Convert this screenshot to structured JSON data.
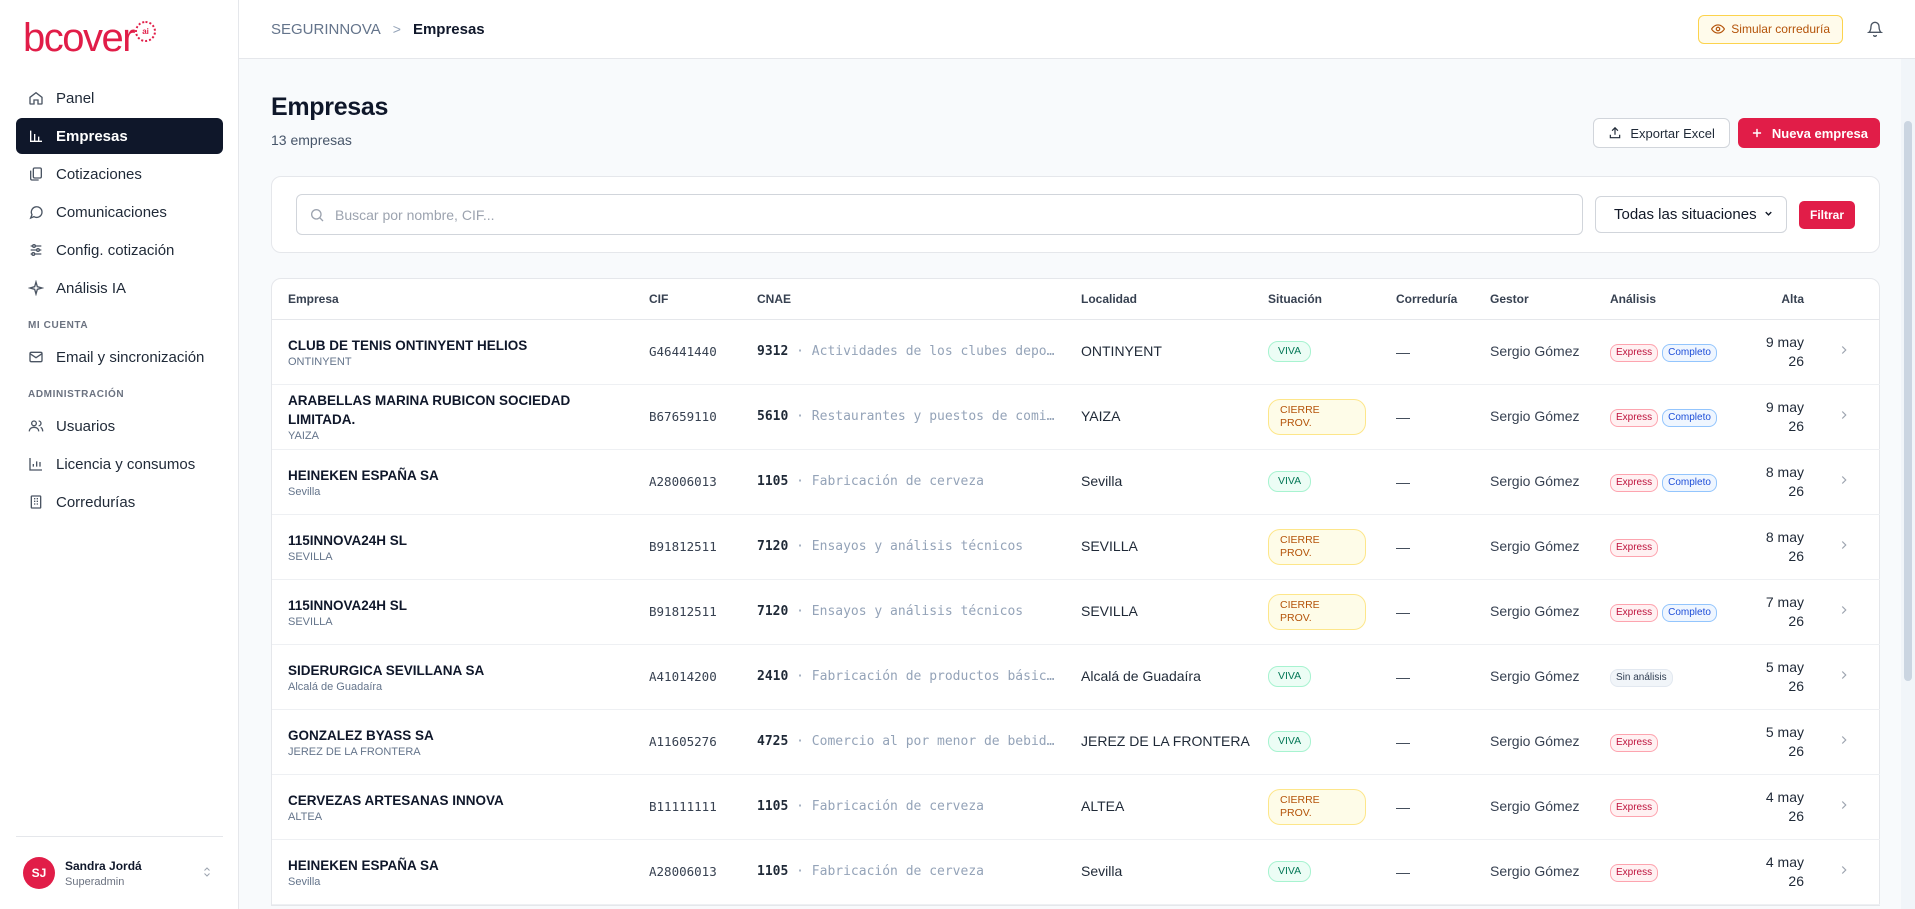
{
  "brand": {
    "logo": "bcover",
    "badge": "ai",
    "accent": "#e11d48"
  },
  "nav": {
    "items": [
      {
        "label": "Panel",
        "icon": "home-icon"
      },
      {
        "label": "Empresas",
        "icon": "bar-chart-icon",
        "active": true
      },
      {
        "label": "Cotizaciones",
        "icon": "copy-icon"
      },
      {
        "label": "Comunicaciones",
        "icon": "message-icon"
      },
      {
        "label": "Config. cotización",
        "icon": "sliders-icon"
      },
      {
        "label": "Análisis IA",
        "icon": "sparkle-icon"
      }
    ],
    "section_account": "MI CUENTA",
    "account_items": [
      {
        "label": "Email y sincronización",
        "icon": "mail-icon"
      }
    ],
    "section_admin": "ADMINISTRACIÓN",
    "admin_items": [
      {
        "label": "Usuarios",
        "icon": "users-icon"
      },
      {
        "label": "Licencia y consumos",
        "icon": "chart-icon"
      },
      {
        "label": "Corredurías",
        "icon": "building-icon"
      }
    ]
  },
  "user": {
    "initials": "SJ",
    "name": "Sandra Jordá",
    "role": "Superadmin"
  },
  "breadcrumb": {
    "root": "SEGURINNOVA",
    "sep": ">",
    "current": "Empresas"
  },
  "topbar": {
    "simulate_label": "Simular correduría"
  },
  "page": {
    "title": "Empresas",
    "count": "13",
    "count_suffix": " empresas",
    "export_label": "Exportar Excel",
    "new_label": "Nueva empresa"
  },
  "filters": {
    "search_placeholder": "Buscar por nombre, CIF...",
    "situation_selected": "Todas las situaciones",
    "filter_label": "Filtrar"
  },
  "table": {
    "headers": [
      "Empresa",
      "CIF",
      "CNAE",
      "Localidad",
      "Situación",
      "Correduría",
      "Gestor",
      "Análisis",
      "Alta"
    ],
    "rows": [
      {
        "name": "CLUB DE TENIS ONTINYENT HELIOS",
        "loc": "ONTINYENT",
        "cif": "G46441440",
        "cnae_code": "9312",
        "cnae_desc": " · Actividades de los clubes depo…",
        "localidad": "ONTINYENT",
        "situacion": "VIVA",
        "correduria": "—",
        "gestor": "Sergio Gómez",
        "analisis": [
          "Express",
          "Completo"
        ],
        "alta": "9 may 26"
      },
      {
        "name": "ARABELLAS MARINA RUBICON SOCIEDAD LIMITADA.",
        "loc": "YAIZA",
        "cif": "B67659110",
        "cnae_code": "5610",
        "cnae_desc": " · Restaurantes y puestos de comi…",
        "localidad": "YAIZA",
        "situacion": "CIERRE PROV.",
        "correduria": "—",
        "gestor": "Sergio Gómez",
        "analisis": [
          "Express",
          "Completo"
        ],
        "alta": "9 may 26"
      },
      {
        "name": "HEINEKEN ESPAÑA SA",
        "loc": "Sevilla",
        "cif": "A28006013",
        "cnae_code": "1105",
        "cnae_desc": " · Fabricación de cerveza",
        "localidad": "Sevilla",
        "situacion": "VIVA",
        "correduria": "—",
        "gestor": "Sergio Gómez",
        "analisis": [
          "Express",
          "Completo"
        ],
        "alta": "8 may 26"
      },
      {
        "name": "115INNOVA24H SL",
        "loc": "SEVILLA",
        "cif": "B91812511",
        "cnae_code": "7120",
        "cnae_desc": " · Ensayos y análisis técnicos",
        "localidad": "SEVILLA",
        "situacion": "CIERRE PROV.",
        "correduria": "—",
        "gestor": "Sergio Gómez",
        "analisis": [
          "Express"
        ],
        "alta": "8 may 26"
      },
      {
        "name": "115INNOVA24H SL",
        "loc": "SEVILLA",
        "cif": "B91812511",
        "cnae_code": "7120",
        "cnae_desc": " · Ensayos y análisis técnicos",
        "localidad": "SEVILLA",
        "situacion": "CIERRE PROV.",
        "correduria": "—",
        "gestor": "Sergio Gómez",
        "analisis": [
          "Express",
          "Completo"
        ],
        "alta": "7 may 26"
      },
      {
        "name": "SIDERURGICA SEVILLANA SA",
        "loc": "Alcalá de Guadaíra",
        "cif": "A41014200",
        "cnae_code": "2410",
        "cnae_desc": " · Fabricación de productos básic…",
        "localidad": "Alcalá de Guadaíra",
        "situacion": "VIVA",
        "correduria": "—",
        "gestor": "Sergio Gómez",
        "analisis": [
          "Sin análisis"
        ],
        "alta": "5 may 26"
      },
      {
        "name": "GONZALEZ BYASS SA",
        "loc": "JEREZ DE LA FRONTERA",
        "cif": "A11605276",
        "cnae_code": "4725",
        "cnae_desc": " · Comercio al por menor de bebid…",
        "localidad": "JEREZ DE LA FRONTERA",
        "situacion": "VIVA",
        "correduria": "—",
        "gestor": "Sergio Gómez",
        "analisis": [
          "Express"
        ],
        "alta": "5 may 26"
      },
      {
        "name": "CERVEZAS ARTESANAS INNOVA",
        "loc": "ALTEA",
        "cif": "B11111111",
        "cnae_code": "1105",
        "cnae_desc": " · Fabricación de cerveza",
        "localidad": "ALTEA",
        "situacion": "CIERRE PROV.",
        "correduria": "—",
        "gestor": "Sergio Gómez",
        "analisis": [
          "Express"
        ],
        "alta": "4 may 26"
      },
      {
        "name": "HEINEKEN ESPAÑA SA",
        "loc": "Sevilla",
        "cif": "A28006013",
        "cnae_code": "1105",
        "cnae_desc": " · Fabricación de cerveza",
        "localidad": "Sevilla",
        "situacion": "VIVA",
        "correduria": "—",
        "gestor": "Sergio Gómez",
        "analisis": [
          "Express"
        ],
        "alta": "4 may 26"
      }
    ]
  }
}
